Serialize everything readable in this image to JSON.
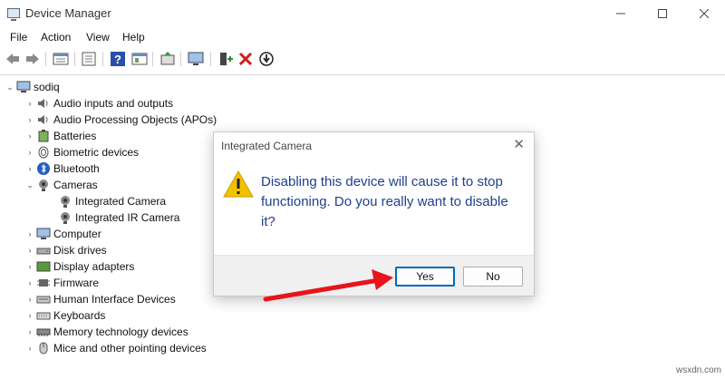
{
  "window": {
    "title": "Device Manager"
  },
  "menu": [
    "File",
    "Action",
    "View",
    "Help"
  ],
  "toolbar": {
    "icons": [
      "back-arrow-icon",
      "forward-arrow-icon",
      "properties-icon",
      "show-hide-icon",
      "help-icon",
      "details-icon",
      "update-driver-icon",
      "scan-hardware-icon",
      "enable-device-icon",
      "uninstall-device-icon",
      "disable-device-icon"
    ]
  },
  "tree": {
    "root": "sodiq",
    "items": [
      {
        "label": "Audio inputs and outputs",
        "icon": "speaker-icon",
        "expanded": false
      },
      {
        "label": "Audio Processing Objects (APOs)",
        "icon": "speaker-icon",
        "expanded": false
      },
      {
        "label": "Batteries",
        "icon": "battery-icon",
        "expanded": false
      },
      {
        "label": "Biometric devices",
        "icon": "fingerprint-icon",
        "expanded": false
      },
      {
        "label": "Bluetooth",
        "icon": "bluetooth-icon",
        "expanded": false
      },
      {
        "label": "Cameras",
        "icon": "camera-icon",
        "expanded": true
      },
      {
        "label": "Integrated Camera",
        "icon": "camera-icon",
        "child": true
      },
      {
        "label": "Integrated IR Camera",
        "icon": "camera-icon",
        "child": true
      },
      {
        "label": "Computer",
        "icon": "computer-icon",
        "expanded": false
      },
      {
        "label": "Disk drives",
        "icon": "disk-icon",
        "expanded": false
      },
      {
        "label": "Display adapters",
        "icon": "display-icon",
        "expanded": false
      },
      {
        "label": "Firmware",
        "icon": "chip-icon",
        "expanded": false
      },
      {
        "label": "Human Interface Devices",
        "icon": "hid-icon",
        "expanded": false
      },
      {
        "label": "Keyboards",
        "icon": "keyboard-icon",
        "expanded": false
      },
      {
        "label": "Memory technology devices",
        "icon": "memory-icon",
        "expanded": false
      },
      {
        "label": "Mice and other pointing devices",
        "icon": "mouse-icon",
        "expanded": false
      }
    ]
  },
  "dialog": {
    "title": "Integrated Camera",
    "message": "Disabling this device will cause it to stop functioning. Do you really want to disable it?",
    "yes_label": "Yes",
    "no_label": "No"
  },
  "watermark": "wsxdn.com",
  "colors": {
    "message": "#1f3f8c",
    "accent": "#0067c0",
    "annotation_arrow": "#e8141b",
    "warning": "#f2c200"
  }
}
